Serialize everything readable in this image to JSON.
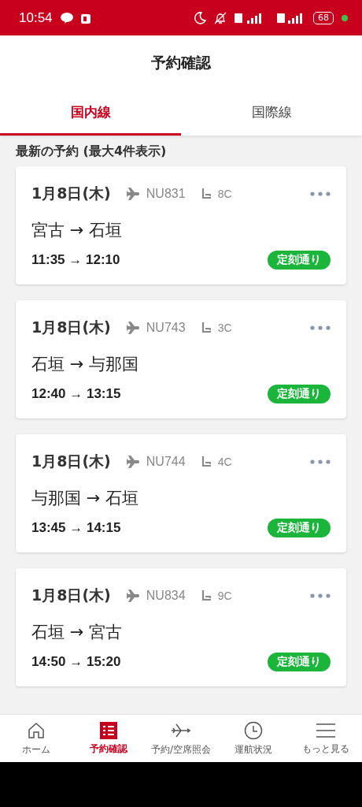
{
  "status_bar": {
    "time": "10:54",
    "battery": "68"
  },
  "header": {
    "title": "予約確認"
  },
  "tabs": [
    {
      "label": "国内線",
      "selected": true
    },
    {
      "label": "国際線",
      "selected": false
    }
  ],
  "section_title": "最新の予約 (最大4件表示)",
  "reservations": [
    {
      "date": "1月8日(木)",
      "flight": "NU831",
      "seat": "8C",
      "route": "宮古 → 石垣",
      "times": "11:35 → 12:10",
      "status": "定刻通り"
    },
    {
      "date": "1月8日(木)",
      "flight": "NU743",
      "seat": "3C",
      "route": "石垣 → 与那国",
      "times": "12:40 → 13:15",
      "status": "定刻通り"
    },
    {
      "date": "1月8日(木)",
      "flight": "NU744",
      "seat": "4C",
      "route": "与那国 → 石垣",
      "times": "13:45 → 14:15",
      "status": "定刻通り"
    },
    {
      "date": "1月8日(木)",
      "flight": "NU834",
      "seat": "9C",
      "route": "石垣 → 宮古",
      "times": "14:50 → 15:20",
      "status": "定刻通り"
    }
  ],
  "bottom_nav": [
    {
      "kind": "home",
      "label": "ホーム",
      "selected": false
    },
    {
      "kind": "list",
      "label": "予約確認",
      "selected": true
    },
    {
      "kind": "plane",
      "label": "予約/空席照会",
      "selected": false
    },
    {
      "kind": "clock",
      "label": "運航状況",
      "selected": false
    },
    {
      "kind": "menu",
      "label": "もっと見る",
      "selected": false
    }
  ]
}
